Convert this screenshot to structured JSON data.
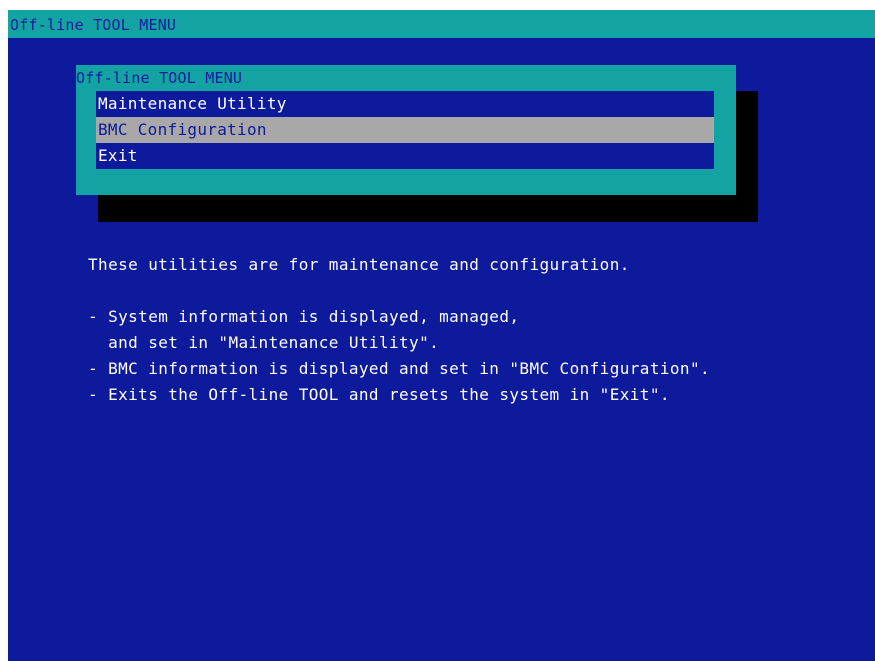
{
  "window": {
    "title": "Off-line TOOL MENU"
  },
  "menu": {
    "title": "Off-line TOOL MENU",
    "items": [
      {
        "label": "Maintenance Utility",
        "selected": false
      },
      {
        "label": "BMC Configuration",
        "selected": true
      },
      {
        "label": "Exit",
        "selected": false
      }
    ]
  },
  "description": {
    "intro": "These utilities are for maintenance and configuration.",
    "bullets": [
      "- System information is displayed, managed,",
      "  and set in \"Maintenance Utility\".",
      "- BMC information is displayed and set in \"BMC Configuration\".",
      "- Exits the Off-line TOOL and resets the system in \"Exit\"."
    ]
  },
  "colors": {
    "background": "#0d1a9c",
    "title_bar": "#13a3a3",
    "menu_frame": "#13a3a3",
    "menu_shadow": "#000000",
    "selected_item": "#a8a8a8",
    "text": "#ffffff"
  }
}
